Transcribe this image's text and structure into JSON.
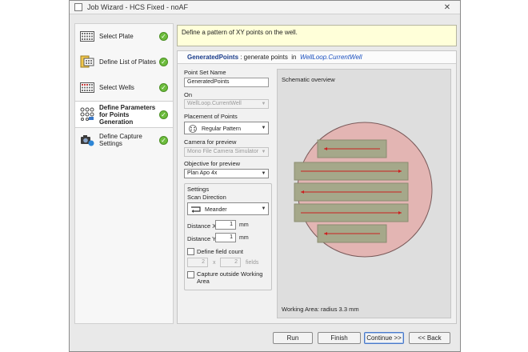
{
  "window": {
    "title": "Job Wizard - HCS Fixed - noAF",
    "close_glyph": "✕"
  },
  "steps": [
    {
      "label": "Select Plate",
      "icon": "plate-icon",
      "done": true
    },
    {
      "label": "Define List of Plates",
      "icon": "plates-list-icon",
      "done": true
    },
    {
      "label": "Select Wells",
      "icon": "wells-icon",
      "done": true
    },
    {
      "label": "Define Parameters for Points Generation",
      "icon": "points-icon",
      "done": true,
      "active": true
    },
    {
      "label": "Define Capture Settings",
      "icon": "camera-icon",
      "done": true
    }
  ],
  "check_glyph": "✓",
  "description": "Define a pattern of XY points on the well.",
  "panel_header": {
    "name": "GeneratedPoints",
    "sep": " : generate points  in  ",
    "target": "WellLoop.CurrentWell"
  },
  "form": {
    "point_set_label": "Point Set Name",
    "point_set_value": "GeneratedPoints",
    "on_label": "On",
    "on_value": "WellLoop.CurrentWell",
    "placement_label": "Placement of Points",
    "placement_value": "Regular Pattern",
    "camera_label": "Camera for preview",
    "camera_value": "Mono File Camera Simulator",
    "objective_label": "Objective for preview",
    "objective_value": "Plan Apo 4x",
    "settings_title": "Settings",
    "scan_label": "Scan Direction",
    "scan_value": "Meander",
    "dist_x_label": "Distance X",
    "dist_x_value": "1",
    "dist_y_label": "Distance Y",
    "dist_y_value": "1",
    "unit": "mm",
    "define_field_label": "Define field count",
    "field_x_value": "2",
    "field_y_value": "2",
    "field_sep": "x",
    "fields_unit": "fields",
    "capture_outside_label": "Capture outside Working Area"
  },
  "schematic": {
    "title": "Schematic overview",
    "working_area": "Working Area: radius 3.3 mm",
    "colors": {
      "well": "#e3b5b3",
      "field": "#a5a88a",
      "arrow": "#cc2020"
    }
  },
  "buttons": {
    "run": "Run",
    "finish": "Finish",
    "continue": "Continue >>",
    "back": "<< Back"
  },
  "dropdown_glyph": "▼"
}
